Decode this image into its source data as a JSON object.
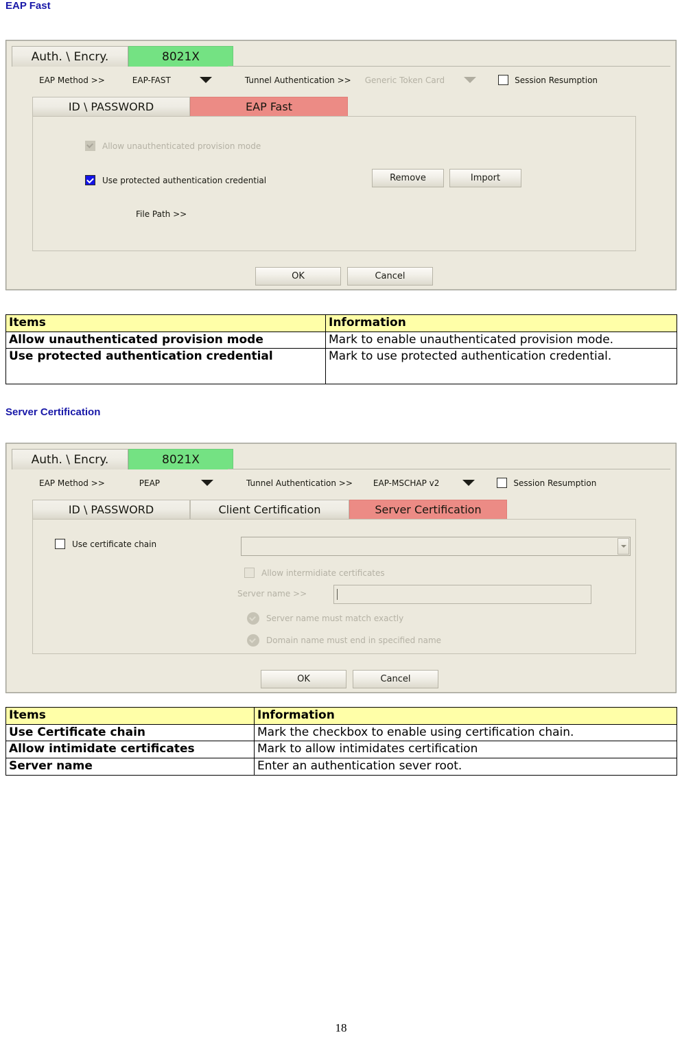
{
  "page": {
    "number": "18"
  },
  "sections": [
    {
      "heading": "EAP Fast"
    },
    {
      "heading": "Server Certification"
    }
  ],
  "dialog1": {
    "top_tabs": [
      {
        "label": "Auth. \\ Encry.",
        "state": "inactive"
      },
      {
        "label": "8021X",
        "state": "active"
      }
    ],
    "eap_method": {
      "label": "EAP Method >>",
      "value": "EAP-FAST",
      "caret": "chevron-down-icon"
    },
    "tunnel_auth": {
      "label": "Tunnel Authentication >>",
      "value": "Generic Token Card",
      "disabled": true,
      "caret": "chevron-down-icon"
    },
    "session_resumption": {
      "label": "Session Resumption",
      "checked": false
    },
    "sub_tabs": [
      {
        "label": "ID \\ PASSWORD",
        "state": "inactive"
      },
      {
        "label": "EAP Fast",
        "state": "active"
      }
    ],
    "allow_unauth": {
      "label": "Allow unauthenticated provision mode",
      "checked": true,
      "disabled": true
    },
    "use_pac": {
      "label": "Use protected authentication credential",
      "checked": true,
      "disabled": false
    },
    "file_path_label": "File Path >>",
    "remove_button": "Remove",
    "import_button": "Import",
    "ok_button": "OK",
    "cancel_button": "Cancel"
  },
  "table1": {
    "headers": [
      "Items",
      "Information"
    ],
    "rows": [
      [
        "Allow unauthenticated provision mode",
        "Mark to enable unauthenticated provision mode."
      ],
      [
        "Use protected authentication credential",
        "Mark to use protected authentication credential."
      ]
    ]
  },
  "dialog2": {
    "top_tabs": [
      {
        "label": "Auth. \\ Encry.",
        "state": "inactive"
      },
      {
        "label": "8021X",
        "state": "active"
      }
    ],
    "eap_method": {
      "label": "EAP Method >>",
      "value": "PEAP",
      "caret": "chevron-down-icon"
    },
    "tunnel_auth": {
      "label": "Tunnel Authentication >>",
      "value": "EAP-MSCHAP v2",
      "disabled": false,
      "caret": "chevron-down-icon"
    },
    "session_resumption": {
      "label": "Session Resumption",
      "checked": false
    },
    "sub_tabs": [
      {
        "label": "ID \\ PASSWORD",
        "state": "inactive"
      },
      {
        "label": "Client Certification",
        "state": "inactive"
      },
      {
        "label": "Server Certification",
        "state": "active"
      }
    ],
    "use_cert_chain": {
      "label": "Use certificate chain",
      "checked": false
    },
    "cert_chain_combo": {
      "value": "",
      "arrow": "chevron-down-icon"
    },
    "allow_intermediate": {
      "label": "Allow intermidiate certificates",
      "checked": false,
      "disabled": true
    },
    "server_name": {
      "label": "Server name >>",
      "value": "",
      "disabled": true
    },
    "radios": [
      {
        "label": "Server name must match exactly",
        "selected": false,
        "disabled": true
      },
      {
        "label": "Domain name must end in specified name",
        "selected": false,
        "disabled": true
      }
    ],
    "ok_button": "OK",
    "cancel_button": "Cancel"
  },
  "table2": {
    "headers": [
      "Items",
      "Information"
    ],
    "rows": [
      [
        "Use Certificate chain",
        "Mark the checkbox to enable using certification chain."
      ],
      [
        "Allow intimidate certificates",
        "Mark to allow intimidates certification"
      ],
      [
        "Server name",
        "Enter an authentication sever root."
      ]
    ]
  },
  "colors": {
    "heading": "#1818a8",
    "dialog_bg": "#ece9dd",
    "tab_active_green": "#74e283",
    "tab_active_red": "#ec8b85",
    "table_header_bg": "#ffffa8",
    "checkbox_checked": "#1414e6"
  }
}
